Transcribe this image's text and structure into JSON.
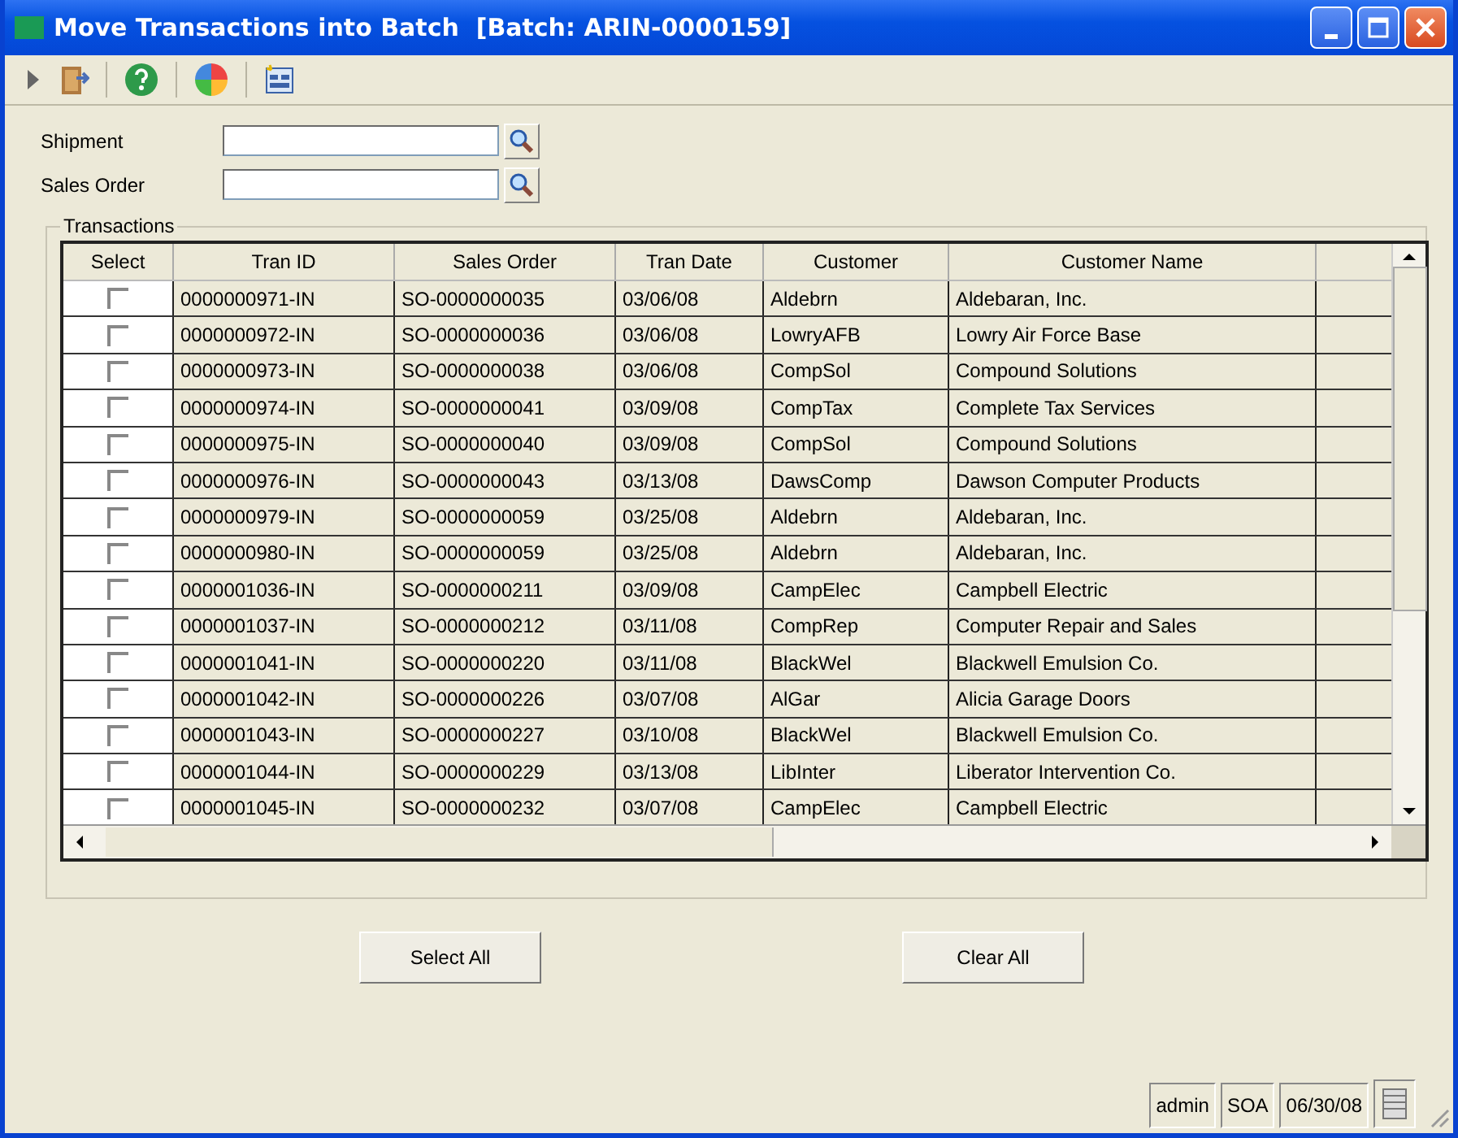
{
  "window": {
    "title": "Move Transactions into Batch  [Batch: ARIN-0000159]"
  },
  "filters": [
    {
      "label": "Shipment"
    },
    {
      "label": "Sales Order"
    }
  ],
  "transactions": {
    "title": "Transactions",
    "select_header": "Select",
    "columns": [
      "Tran ID",
      "Sales Order",
      "Tran Date",
      "Customer",
      "Customer Name"
    ],
    "rows": [
      {
        "checked": false,
        "cells": [
          "0000000971-IN",
          "SO-0000000035",
          "03/06/08",
          "Aldebrn",
          "Aldebaran, Inc."
        ]
      },
      {
        "checked": false,
        "cells": [
          "0000000972-IN",
          "SO-0000000036",
          "03/06/08",
          "LowryAFB",
          "Lowry Air Force Base"
        ]
      },
      {
        "checked": false,
        "cells": [
          "0000000973-IN",
          "SO-0000000038",
          "03/06/08",
          "CompSol",
          "Compound Solutions"
        ]
      },
      {
        "checked": false,
        "cells": [
          "0000000974-IN",
          "SO-0000000041",
          "03/09/08",
          "CompTax",
          "Complete Tax Services"
        ]
      },
      {
        "checked": false,
        "cells": [
          "0000000975-IN",
          "SO-0000000040",
          "03/09/08",
          "CompSol",
          "Compound Solutions"
        ]
      },
      {
        "checked": false,
        "cells": [
          "0000000976-IN",
          "SO-0000000043",
          "03/13/08",
          "DawsComp",
          "Dawson Computer Products"
        ]
      },
      {
        "checked": false,
        "cells": [
          "0000000979-IN",
          "SO-0000000059",
          "03/25/08",
          "Aldebrn",
          "Aldebaran, Inc."
        ]
      },
      {
        "checked": false,
        "cells": [
          "0000000980-IN",
          "SO-0000000059",
          "03/25/08",
          "Aldebrn",
          "Aldebaran, Inc."
        ]
      },
      {
        "checked": false,
        "cells": [
          "0000001036-IN",
          "SO-0000000211",
          "03/09/08",
          "CampElec",
          "Campbell Electric"
        ]
      },
      {
        "checked": false,
        "cells": [
          "0000001037-IN",
          "SO-0000000212",
          "03/11/08",
          "CompRep",
          "Computer Repair and Sales"
        ]
      },
      {
        "checked": false,
        "cells": [
          "0000001041-IN",
          "SO-0000000220",
          "03/11/08",
          "BlackWel",
          "Blackwell Emulsion Co."
        ]
      },
      {
        "checked": false,
        "cells": [
          "0000001042-IN",
          "SO-0000000226",
          "03/07/08",
          "AlGar",
          "Alicia Garage Doors"
        ]
      },
      {
        "checked": false,
        "cells": [
          "0000001043-IN",
          "SO-0000000227",
          "03/10/08",
          "BlackWel",
          "Blackwell Emulsion Co."
        ]
      },
      {
        "checked": false,
        "cells": [
          "0000001044-IN",
          "SO-0000000229",
          "03/13/08",
          "LibInter",
          "Liberator Intervention Co."
        ]
      },
      {
        "checked": false,
        "cells": [
          "0000001045-IN",
          "SO-0000000232",
          "03/07/08",
          "CampElec",
          "Campbell Electric"
        ]
      }
    ]
  },
  "buttons": [
    "Select All",
    "Clear All"
  ],
  "status_bar": [
    "admin",
    "SOA",
    "06/30/08"
  ]
}
